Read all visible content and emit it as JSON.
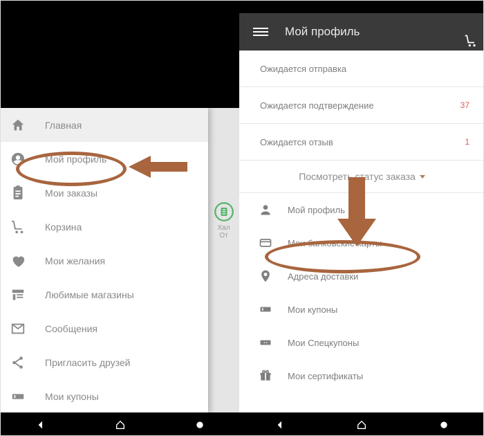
{
  "left": {
    "menu": [
      {
        "label": "Главная"
      },
      {
        "label": "Мой профиль"
      },
      {
        "label": "Мои заказы"
      },
      {
        "label": "Корзина"
      },
      {
        "label": "Мои желания"
      },
      {
        "label": "Любимые магазины"
      },
      {
        "label": "Сообщения"
      },
      {
        "label": "Пригласить друзей"
      },
      {
        "label": "Мои купоны"
      }
    ],
    "peek1": "Хал",
    "peek2": "От"
  },
  "right": {
    "title": "Мой профиль",
    "status": [
      {
        "label": "Ожидается отправка",
        "count": ""
      },
      {
        "label": "Ожидается подтверждение",
        "count": "37"
      },
      {
        "label": "Ожидается отзыв",
        "count": "1"
      }
    ],
    "viewStatus": "Посмотреть статус заказа",
    "account": [
      {
        "label": "Мой профиль"
      },
      {
        "label": "Мои банковские карты"
      },
      {
        "label": "Адреса доставки"
      },
      {
        "label": "Мои купоны"
      },
      {
        "label": "Мои Спецкупоны"
      },
      {
        "label": "Мои сертификаты"
      }
    ]
  }
}
